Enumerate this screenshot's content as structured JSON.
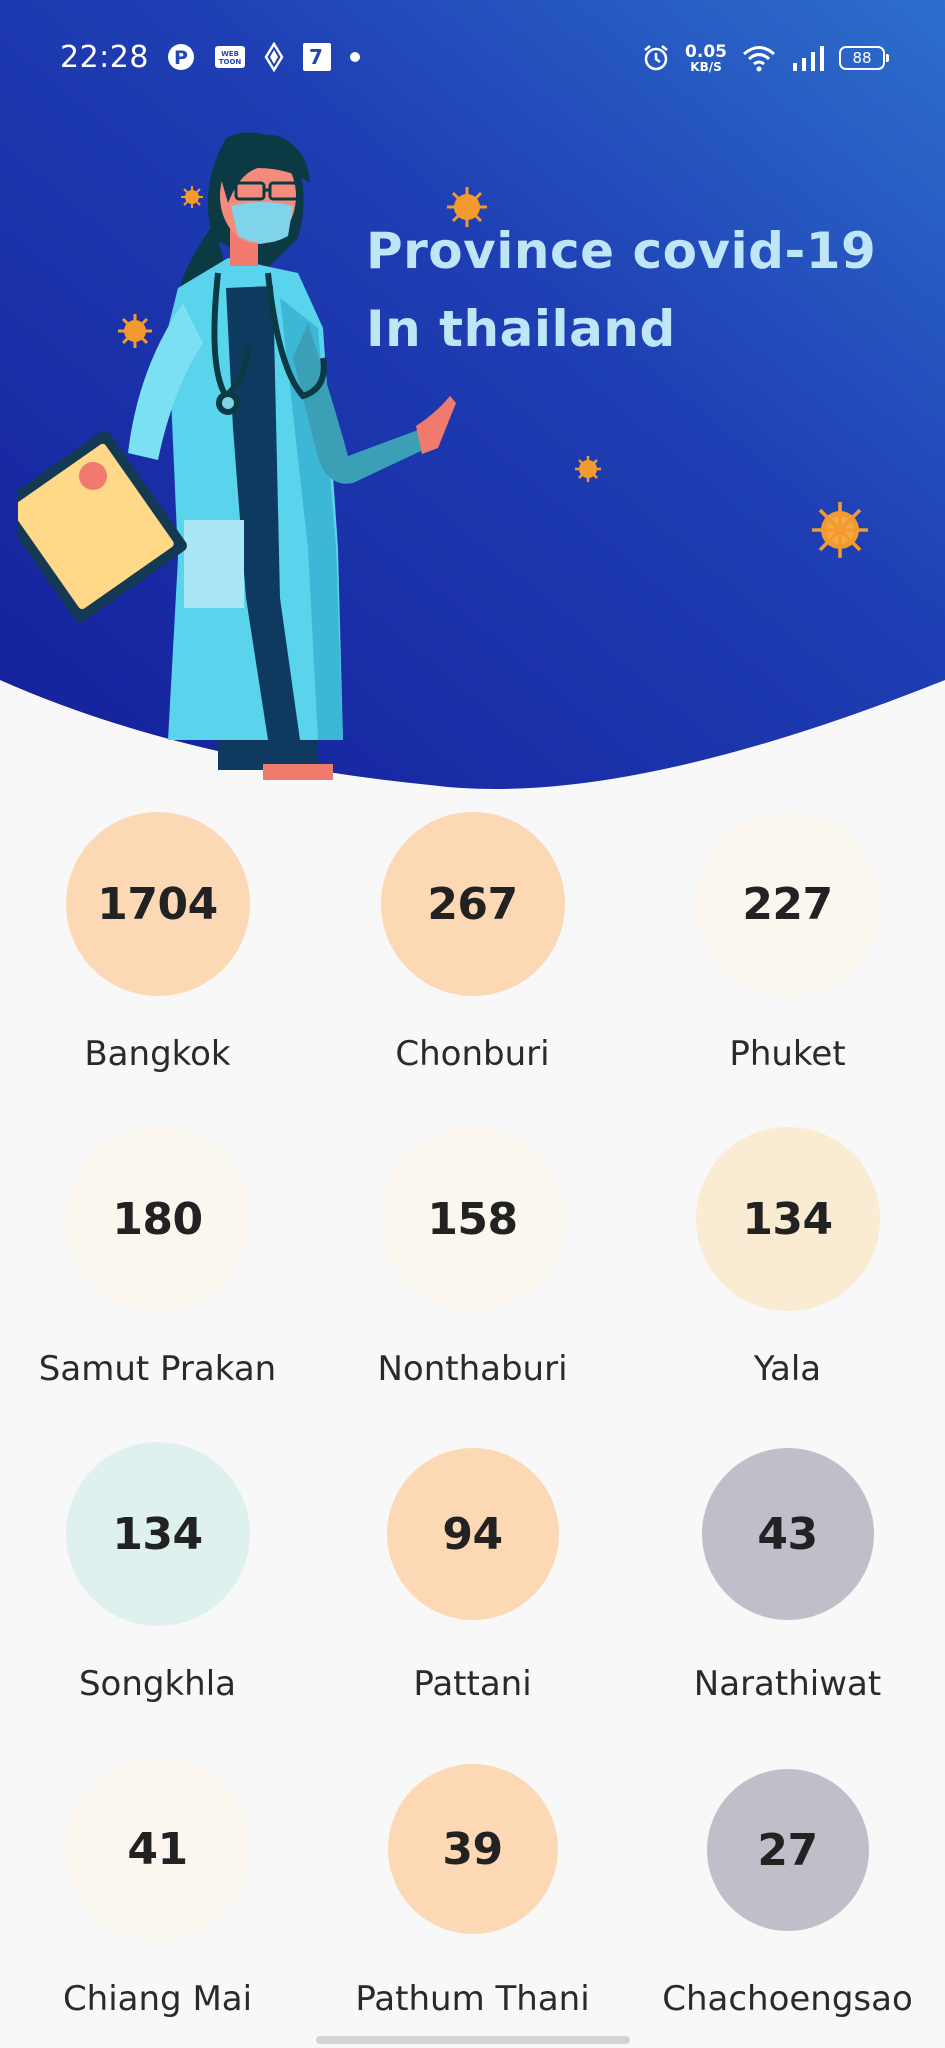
{
  "status_bar": {
    "time": "22:28",
    "left_icons": [
      "pinterest-icon",
      "webtoon-icon",
      "diamond-icon",
      "seven-eleven-icon",
      "notification-dot-icon"
    ],
    "net_speed_value": "0.05",
    "net_speed_unit": "KB/S",
    "battery": "88",
    "right_icons": [
      "alarm-icon",
      "wifi-icon",
      "signal-icon",
      "battery-icon"
    ]
  },
  "header": {
    "title_line1": "Province covid-19",
    "title_line2": "In thailand",
    "title_color": "#bfe6f7",
    "background_colors": [
      "#1b2aa0",
      "#2a64c8"
    ]
  },
  "provinces": [
    {
      "name": "Bangkok",
      "count": "1704",
      "color": "#fcd8b4"
    },
    {
      "name": "Chonburi",
      "count": "267",
      "color": "#fcd8b4"
    },
    {
      "name": "Phuket",
      "count": "227",
      "color": "#fbf6ee"
    },
    {
      "name": "Samut Prakan",
      "count": "180",
      "color": "#fbf6ee"
    },
    {
      "name": "Nonthaburi",
      "count": "158",
      "color": "#fbf6ee"
    },
    {
      "name": "Yala",
      "count": "134",
      "color": "#f9ecd3"
    },
    {
      "name": "Songkhla",
      "count": "134",
      "color": "#dff1ef"
    },
    {
      "name": "Pattani",
      "count": "94",
      "color": "#fcd8b4"
    },
    {
      "name": "Narathiwat",
      "count": "43",
      "color": "#bfbec9"
    },
    {
      "name": "Chiang Mai",
      "count": "41",
      "color": "#fbf6ee"
    },
    {
      "name": "Pathum Thani",
      "count": "39",
      "color": "#fcd8b4"
    },
    {
      "name": "Chachoengsao",
      "count": "27",
      "color": "#bfbec9"
    }
  ]
}
